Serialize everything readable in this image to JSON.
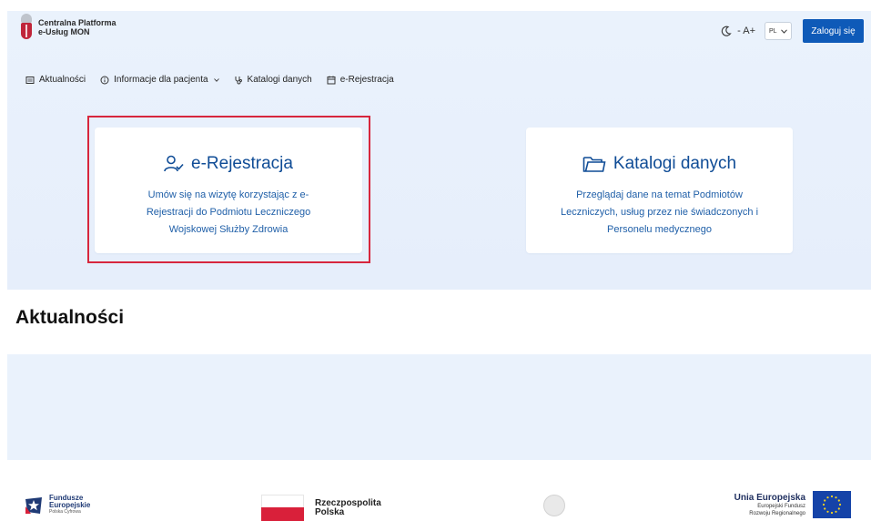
{
  "header": {
    "logo_line1": "Centralna Platforma",
    "logo_line2": "e-Usług MON",
    "font_size_label": "- A+",
    "language": "PL",
    "login_label": "Zaloguj się"
  },
  "nav": {
    "items": [
      {
        "label": "Aktualności",
        "icon": "news-icon"
      },
      {
        "label": "Informacje dla pacjenta",
        "icon": "info-icon",
        "has_dropdown": true
      },
      {
        "label": "Katalogi danych",
        "icon": "stethoscope-icon"
      },
      {
        "label": "e-Rejestracja",
        "icon": "calendar-icon"
      }
    ]
  },
  "cards": {
    "registration": {
      "title": "e-Rejestracja",
      "desc_line1": "Umów się na wizytę korzystając z e-",
      "desc_line2": "Rejestracji do Podmiotu Leczniczego",
      "desc_line3": "Wojskowej Służby Zdrowia",
      "icon": "user-check-icon"
    },
    "catalogs": {
      "title": "Katalogi danych",
      "desc_line1": "Przeglądaj dane na temat Podmiotów",
      "desc_line2": "Leczniczych, usług przez nie świadczonych i",
      "desc_line3": "Personelu medycznego",
      "icon": "folder-icon"
    }
  },
  "news": {
    "title": "Aktualności"
  },
  "footer": {
    "fe_line1": "Fundusze",
    "fe_line2": "Europejskie",
    "fe_line3": "Polska Cyfrowa",
    "rp_line1": "Rzeczpospolita",
    "rp_line2": "Polska",
    "ue_line1": "Unia Europejska",
    "ue_line2": "Europejski Fundusz",
    "ue_line3": "Rozwoju Regionalnego"
  },
  "colors": {
    "accent": "#0e5ab8",
    "card_title": "#0f4c96",
    "highlight": "#d7263d",
    "hero_bg": "#e6eefb"
  }
}
